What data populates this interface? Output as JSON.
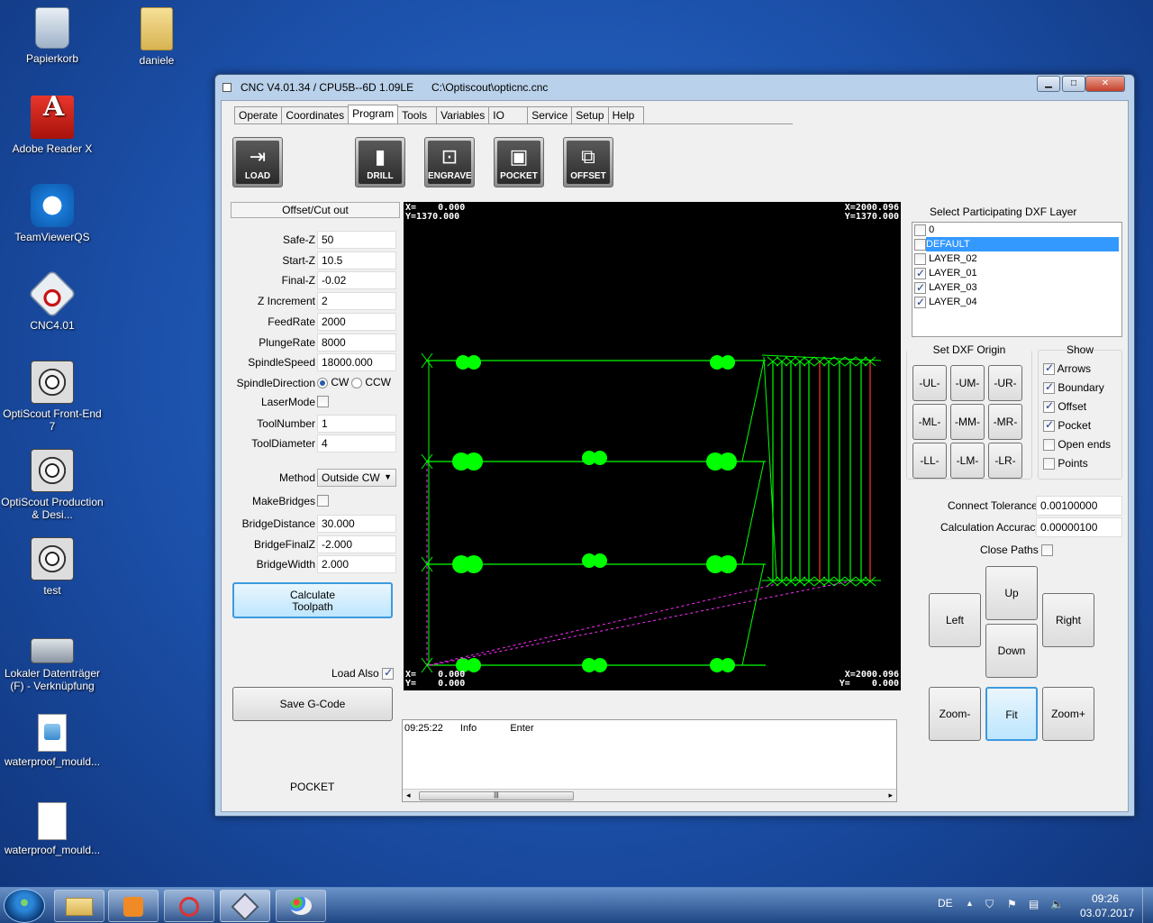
{
  "desktop": {
    "icons": [
      {
        "label": "Papierkorb"
      },
      {
        "label": "daniele"
      },
      {
        "label": "Adobe Reader X"
      },
      {
        "label": "TeamViewerQS"
      },
      {
        "label": "CNC4.01"
      },
      {
        "label": "OptiScout Front-End 7"
      },
      {
        "label": "OptiScout Production & Desi..."
      },
      {
        "label": "test"
      },
      {
        "label": "Lokaler Datenträger (F) - Verknüpfung"
      },
      {
        "label": "waterproof_mould..."
      },
      {
        "label": "waterproof_mould..."
      }
    ]
  },
  "window": {
    "title": "CNC V4.01.34 / CPU5B--6D 1.09LE",
    "path": "C:\\Optiscout\\opticnc.cnc",
    "min": "▁",
    "max": "□",
    "close": "✕"
  },
  "tabs": [
    "Operate",
    "Coordinates",
    "Program",
    "Tools",
    "Variables",
    "IO",
    "Service",
    "Setup",
    "Help"
  ],
  "active_tab": "Program",
  "toolbar": {
    "load": "LOAD",
    "drill": "DRILL",
    "engrave": "ENGRAVE",
    "pocket": "POCKET",
    "offset": "OFFSET"
  },
  "left": {
    "title": "Offset/Cut out",
    "safe_z_label": "Safe-Z",
    "safe_z": "50",
    "start_z_label": "Start-Z",
    "start_z": "10.5",
    "final_z_label": "Final-Z",
    "final_z": "-0.02",
    "z_inc_label": "Z Increment",
    "z_inc": "2",
    "feedrate_label": "FeedRate",
    "feedrate": "2000",
    "plunge_label": "PlungeRate",
    "plunge": "8000",
    "spindle_speed_label": "SpindleSpeed",
    "spindle_speed": "18000.000",
    "spindle_dir_label": "SpindleDirection",
    "cw": "CW",
    "ccw": "CCW",
    "laser_label": "LaserMode",
    "toolnum_label": "ToolNumber",
    "toolnum": "1",
    "tooldia_label": "ToolDiameter",
    "tooldia": "4",
    "method_label": "Method",
    "method": "Outside CW",
    "makebridges_label": "MakeBridges",
    "bridgedist_label": "BridgeDistance",
    "bridgedist": "30.000",
    "bridgefinal_label": "BridgeFinalZ",
    "bridgefinal": "-2.000",
    "bridgewidth_label": "BridgeWidth",
    "bridgewidth": "2.000",
    "calc_line1": "Calculate",
    "calc_line2": "Toolpath",
    "loadalso_label": "Load Also",
    "save_gcode": "Save G-Code",
    "mode": "POCKET"
  },
  "canvas": {
    "tl": "X=    0.000\nY=1370.000",
    "tr": "X=2000.096\nY=1370.000",
    "bl": "X=    0.000\nY=    0.000",
    "br": "X=2000.096\nY=    0.000"
  },
  "log": {
    "time": "09:25:22",
    "level": "Info",
    "message": "Enter",
    "scroll_grip": "|||"
  },
  "right": {
    "layers_title": "Select Participating DXF Layer",
    "layers": [
      {
        "name": "0",
        "checked": false
      },
      {
        "name": "DEFAULT",
        "checked": false
      },
      {
        "name": "LAYER_02",
        "checked": false
      },
      {
        "name": "LAYER_01",
        "checked": true
      },
      {
        "name": "LAYER_03",
        "checked": true
      },
      {
        "name": "LAYER_04",
        "checked": true
      }
    ],
    "origin_title": "Set DXF Origin",
    "origin": [
      "-UL-",
      "-UM-",
      "-UR-",
      "-ML-",
      "-MM-",
      "-MR-",
      "-LL-",
      "-LM-",
      "-LR-"
    ],
    "show_title": "Show",
    "show": [
      {
        "label": "Arrows",
        "checked": true
      },
      {
        "label": "Boundary",
        "checked": true
      },
      {
        "label": "Offset",
        "checked": true
      },
      {
        "label": "Pocket",
        "checked": true
      },
      {
        "label": "Open ends",
        "checked": false
      },
      {
        "label": "Points",
        "checked": false
      }
    ],
    "connect_tol_label": "Connect Tolerance",
    "connect_tol": "0.00100000",
    "calc_acc_label": "Calculation Accuracy",
    "calc_acc": "0.00000100",
    "close_paths_label": "Close Paths",
    "up": "Up",
    "down": "Down",
    "left": "Left",
    "right": "Right",
    "zoom_minus": "Zoom-",
    "fit": "Fit",
    "zoom_plus": "Zoom+"
  },
  "taskbar": {
    "lang": "DE",
    "time": "09:26",
    "date": "03.07.2017"
  },
  "colors": {
    "canvas_bg": "#000000",
    "path_green": "#00ff00",
    "path_red": "#ff3a2a",
    "path_magenta": "#ff2bff",
    "selection": "#3399ff"
  }
}
